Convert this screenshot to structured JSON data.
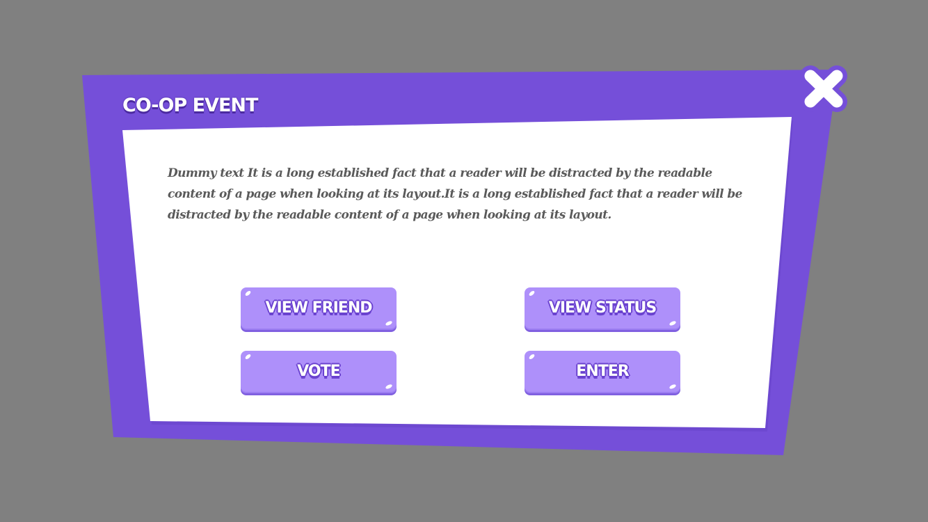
{
  "dialog": {
    "title": "CO-OP EVENT",
    "body": "Dummy text It is a long established fact that a reader will be distracted by the readable content of a page when looking at its layout.It is a long established fact that a reader will be distracted by the readable content of a page when looking at its layout."
  },
  "buttons": {
    "view_friend": "VIEW FRIEND",
    "view_status": "VIEW STATUS",
    "vote": "VOTE",
    "enter": "ENTER"
  },
  "icons": {
    "close": "close-icon"
  },
  "colors": {
    "background": "#808080",
    "frame": "#754fd9",
    "panel": "#ffffff",
    "button": "#ae90fa",
    "button_outline": "#6a42cf",
    "body_text": "#5a5a5a"
  }
}
